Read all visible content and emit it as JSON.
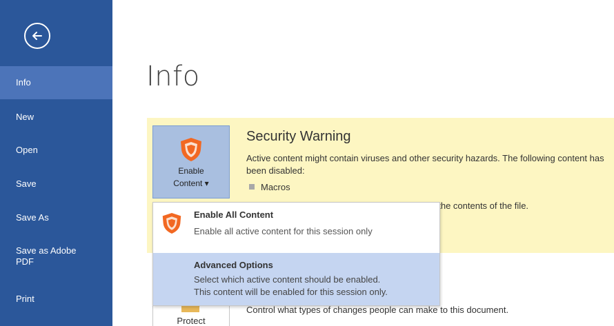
{
  "sidebar": {
    "back_icon": "back-arrow-icon",
    "items": [
      {
        "label": "Info",
        "active": true
      },
      {
        "label": "New"
      },
      {
        "label": "Open"
      },
      {
        "label": "Save"
      },
      {
        "label": "Save As"
      },
      {
        "label": "Save as Adobe PDF"
      },
      {
        "label": "Print"
      }
    ]
  },
  "main": {
    "title": "Info",
    "security": {
      "enable_button": {
        "line1": "Enable",
        "line2": "Content ▾",
        "icon": "shield-icon"
      },
      "title": "Security Warning",
      "text": "Active content might contain viruses and other security hazards. The following content has been disabled:",
      "disabled_item": "Macros",
      "partial_text": "t the contents of the file."
    },
    "protect": {
      "label": "Protect",
      "icon": "lock-icon",
      "description": "Control what types of changes people can make to this document."
    }
  },
  "dropdown": {
    "items": [
      {
        "title": "Enable All Content",
        "desc1": "Enable all active content for this session only",
        "icon": "shield-icon"
      },
      {
        "title": "Advanced Options",
        "desc1": "Select which active content should be enabled.",
        "desc2": "This content will be enabled for this session only.",
        "highlighted": true
      }
    ]
  },
  "colors": {
    "sidebar": "#2b579a",
    "sidebar_active": "#4c74b9",
    "warning_bg": "#fdf6c2",
    "shield": "#f26822",
    "highlight": "#c5d5f1"
  }
}
